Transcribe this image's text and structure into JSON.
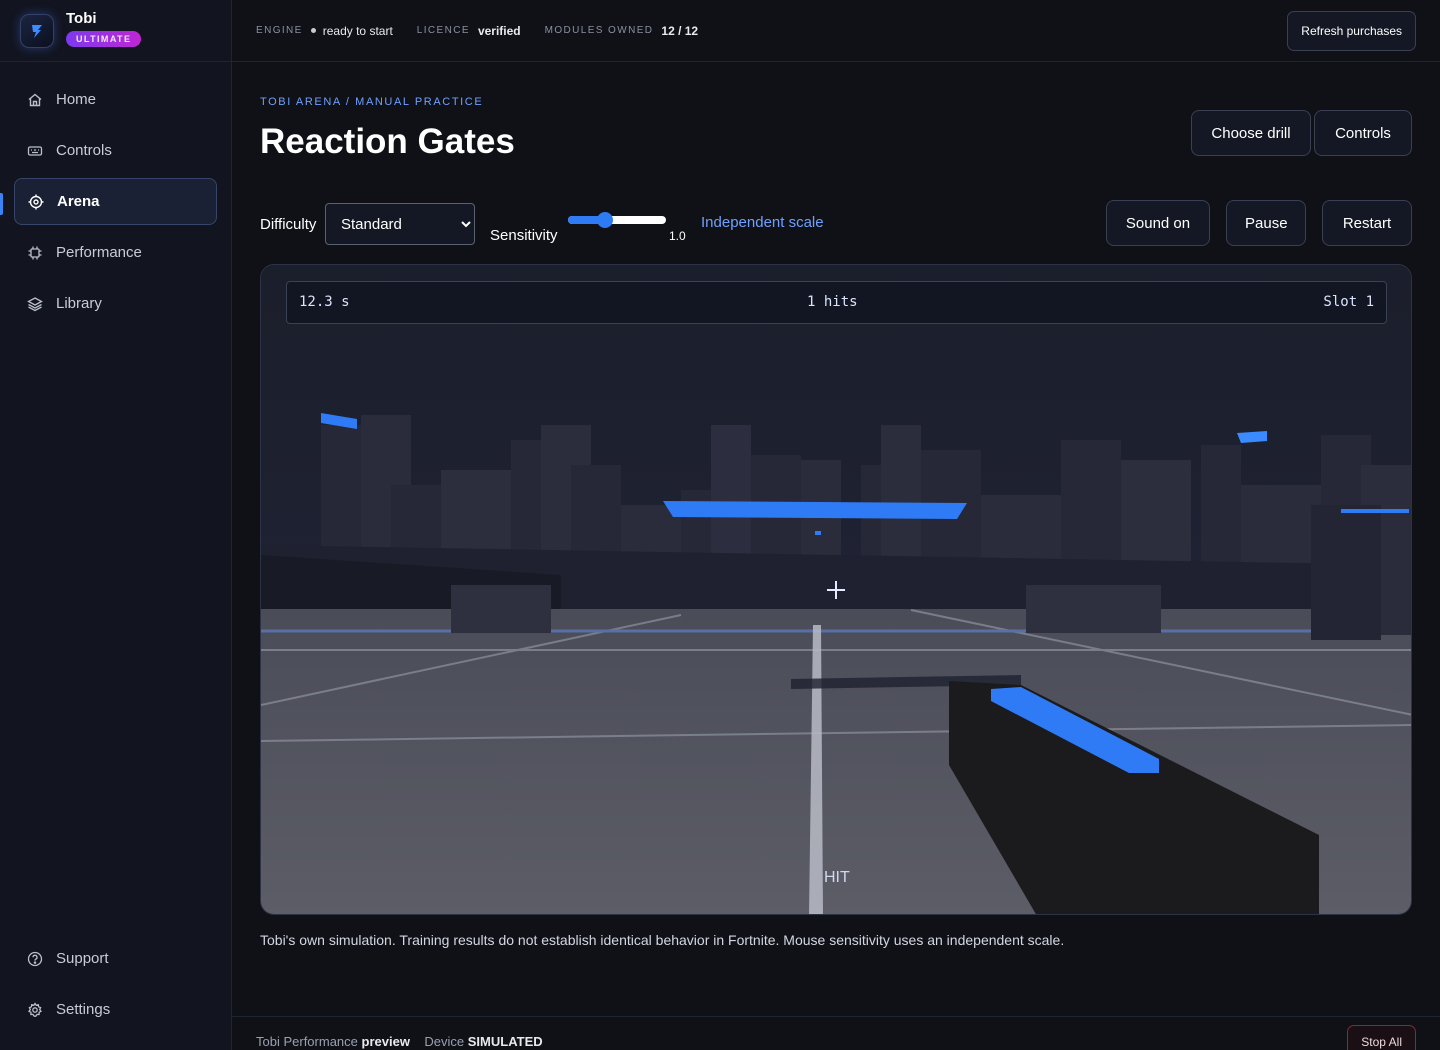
{
  "brand": {
    "name": "Tobi",
    "badge": "ULTIMATE"
  },
  "nav": {
    "items": [
      {
        "label": "Home",
        "icon": "home-icon"
      },
      {
        "label": "Controls",
        "icon": "keyboard-icon"
      },
      {
        "label": "Arena",
        "icon": "target-icon",
        "active": true
      },
      {
        "label": "Performance",
        "icon": "chip-icon"
      },
      {
        "label": "Library",
        "icon": "layers-icon"
      }
    ],
    "bottom": [
      {
        "label": "Support",
        "icon": "help-circle-icon"
      },
      {
        "label": "Settings",
        "icon": "gear-icon"
      }
    ]
  },
  "topbar": {
    "engine_label": "ENGINE",
    "engine_value": "ready to start",
    "licence_label": "LICENCE",
    "licence_value": "verified",
    "modules_label": "MODULES OWNED",
    "modules_value": "12 / 12",
    "refresh_label": "Refresh purchases"
  },
  "page": {
    "breadcrumb": "TOBI ARENA / MANUAL PRACTICE",
    "title": "Reaction Gates",
    "choose_drill_label": "Choose drill",
    "controls_label": "Controls"
  },
  "controls": {
    "difficulty_label": "Difficulty",
    "difficulty_value": "Standard",
    "sensitivity_label": "Sensitivity",
    "sensitivity_value": "1.0",
    "sensitivity_fraction": 0.38,
    "independent_label": "Independent scale",
    "sound_label": "Sound on",
    "pause_label": "Pause",
    "restart_label": "Restart"
  },
  "hud": {
    "timer": "12.3 s",
    "hits": "1 hits",
    "slot": "Slot 1",
    "hit_text": "HIT"
  },
  "disclaimer": "Tobi's own simulation. Training results do not establish identical behavior in Fortnite. Mouse sensitivity uses an independent scale.",
  "footer": {
    "product": "Tobi Performance",
    "product_state": "preview",
    "device_label": "Device",
    "device_value": "SIMULATED",
    "stop_label": "Stop All"
  },
  "colors": {
    "accent": "#3b82f6",
    "badge_from": "#7c3aed",
    "badge_to": "#c026d3"
  }
}
